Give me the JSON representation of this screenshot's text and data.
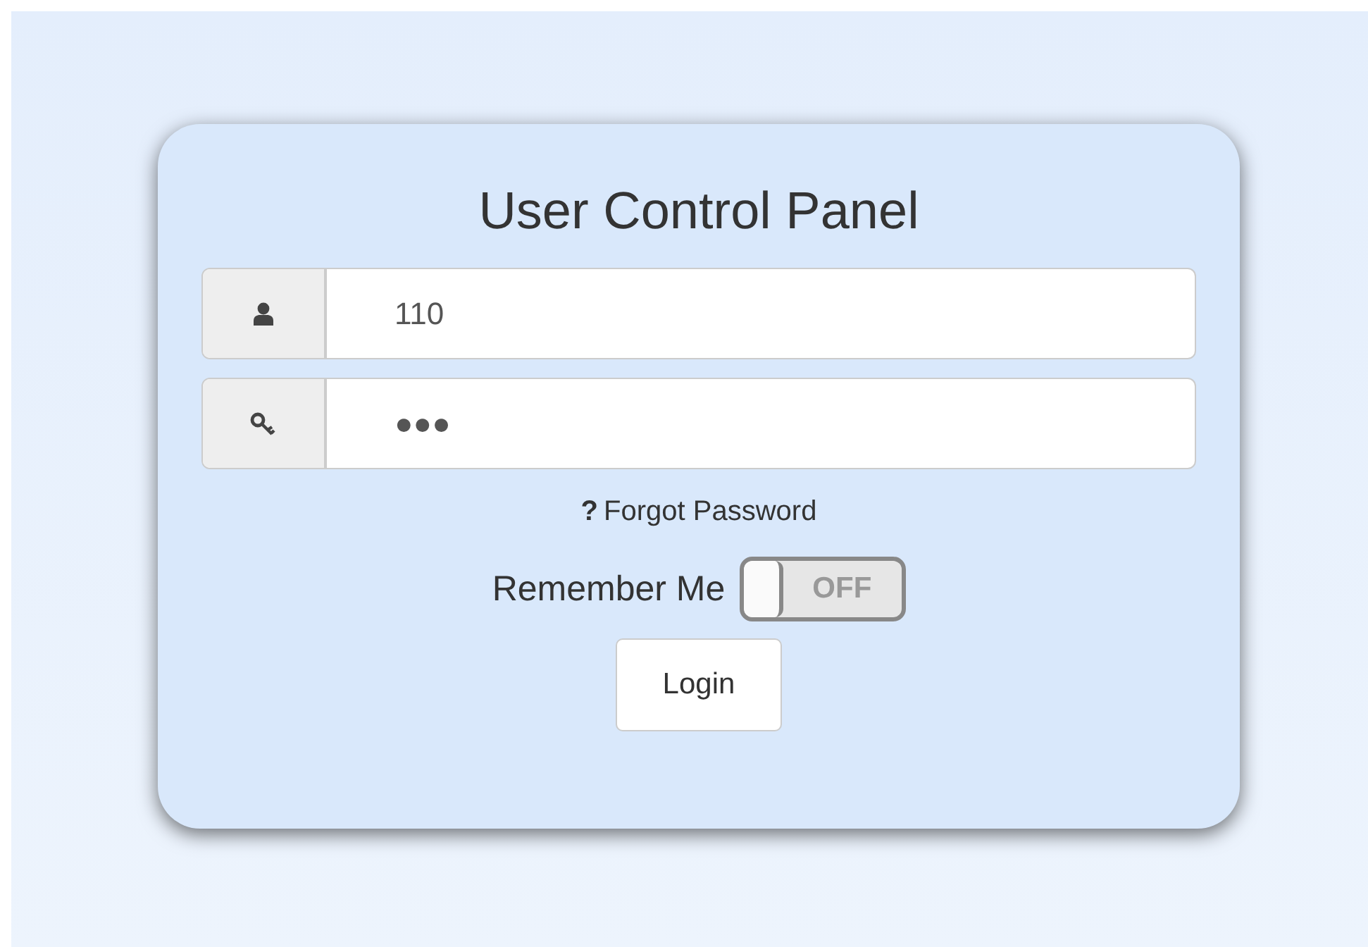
{
  "title": "User Control Panel",
  "fields": [
    {
      "kind": "user",
      "value": "110"
    },
    {
      "kind": "password",
      "value": "●●●"
    }
  ],
  "forgot": {
    "icon": "?",
    "label": "Forgot Password"
  },
  "remember": {
    "label": "Remember Me",
    "on": false,
    "state_label": "OFF"
  },
  "login_button": "Login"
}
